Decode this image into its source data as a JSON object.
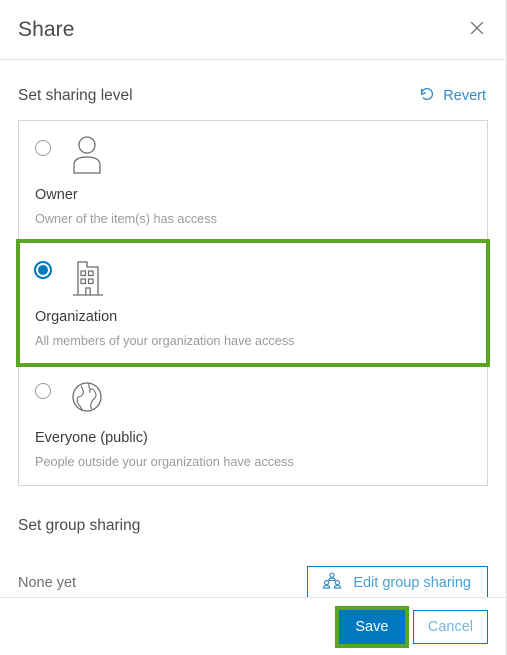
{
  "header": {
    "title": "Share",
    "close_icon": "close-icon"
  },
  "sharing_level": {
    "section_title": "Set sharing level",
    "revert_label": "Revert",
    "revert_icon": "revert-arrow-icon",
    "options": [
      {
        "id": "owner",
        "label": "Owner",
        "description": "Owner of the item(s) has access",
        "icon": "person-icon",
        "selected": false,
        "highlighted": false
      },
      {
        "id": "organization",
        "label": "Organization",
        "description": "All members of your organization have access",
        "icon": "building-icon",
        "selected": true,
        "highlighted": true
      },
      {
        "id": "everyone",
        "label": "Everyone (public)",
        "description": "People outside your organization have access",
        "icon": "globe-icon",
        "selected": false,
        "highlighted": false
      }
    ]
  },
  "group_sharing": {
    "section_title": "Set group sharing",
    "status_text": "None yet",
    "edit_button_label": "Edit group sharing",
    "edit_button_icon": "group-people-icon"
  },
  "footer": {
    "save_label": "Save",
    "cancel_label": "Cancel",
    "save_highlighted": true
  },
  "colors": {
    "accent_blue": "#0079C1",
    "link_blue": "#2E8CC6",
    "highlight_green": "#5BA524",
    "text_dark": "#3C3C3C",
    "text_muted": "#9B9B9B",
    "border_gray": "#D6D6D6"
  }
}
